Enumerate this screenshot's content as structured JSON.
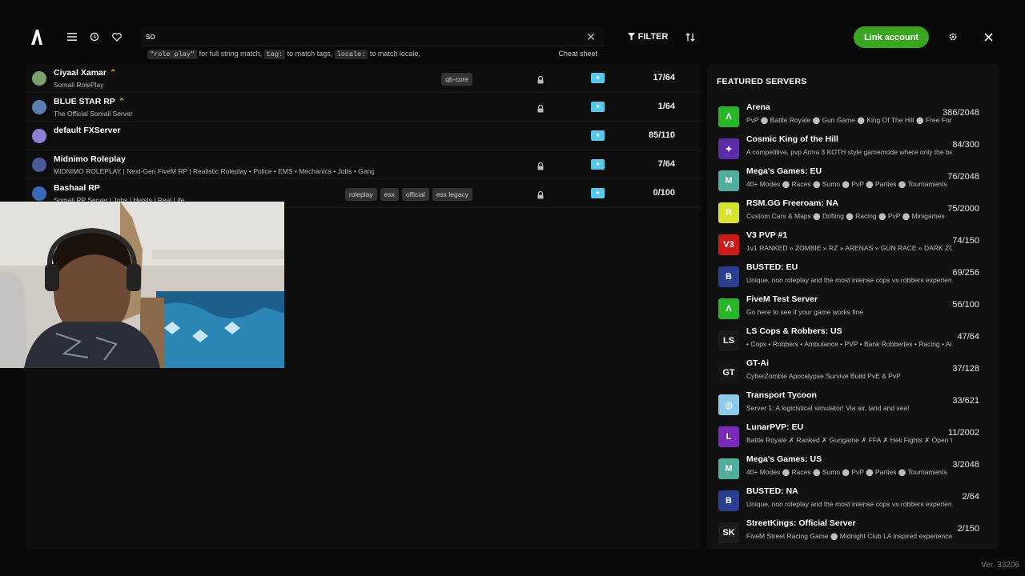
{
  "colors": {
    "accent": "#3aa51f",
    "flag": "#58c8e8",
    "boost": "#e5b63a"
  },
  "nav": {
    "logo": "fivem-logo",
    "menu_icon": "hamburger-icon",
    "history_icon": "history-icon",
    "favorites_icon": "heart-icon"
  },
  "search": {
    "value": "so",
    "hint_1_code": "\"role play\"",
    "hint_1_text": "for full string match,",
    "hint_2_code": "tag:",
    "hint_2_text": "to match tags,",
    "hint_3_code": "locale:",
    "hint_3_text": "to match locale,",
    "cheat_sheet": "Cheat sheet"
  },
  "toolbar": {
    "filter_label": "FILTER",
    "link_account": "Link account"
  },
  "servers": [
    {
      "name": "Ciyaal Xamar",
      "boosted": true,
      "desc": "Somali RolePlay",
      "tags": [
        "qb-core"
      ],
      "locked": true,
      "flag": "★",
      "players": "17/64"
    },
    {
      "name": "BLUE STAR RP",
      "boosted": true,
      "desc": "The Official Somali Server",
      "tags": [],
      "locked": true,
      "flag": "★",
      "players": "1/64"
    },
    {
      "name": "default FXServer",
      "boosted": false,
      "desc": "",
      "tags": [],
      "locked": false,
      "flag": "★",
      "players": "85/110"
    },
    {
      "name": "Midnimo Roleplay",
      "boosted": false,
      "desc": "MIDNIMO ROLEPLAY | Next-Gen FiveM RP | Realistic Roleplay • Police • EMS • Mechanics • Jobs • Gangs",
      "tags": [],
      "locked": true,
      "flag": "★",
      "players": "7/64"
    },
    {
      "name": "Bashaal RP",
      "boosted": false,
      "desc": "Somali RP Server | Jobs | Heists | Real Life",
      "tags": [
        "roleplay",
        "esx",
        "official",
        "esx legacy"
      ],
      "locked": true,
      "flag": "★",
      "players": "0/100"
    }
  ],
  "featured": {
    "title": "FEATURED SERVERS",
    "items": [
      {
        "name": "Arena",
        "desc": "PvP ⬤ Battle Royale ⬤ Gun Game ⬤ King Of The Hill ⬤ Free For All",
        "players": "386/2048",
        "icon_color": "#2ab52a",
        "icon_text": "Λ"
      },
      {
        "name": "Cosmic King of the Hill",
        "desc": "A competitive, pvp Arma 3 KOTH style gamemode where only the best survive",
        "players": "84/300",
        "icon_color": "#5a2ca8",
        "icon_text": "✦"
      },
      {
        "name": "Mega's Games: EU",
        "desc": "40+ Modes ⬤ Races ⬤ Sumo ⬤ PvP ⬤ Parties ⬤ Tournaments",
        "players": "76/2048",
        "icon_color": "#4fae9e",
        "icon_text": "M"
      },
      {
        "name": "RSM.GG Freeroam: NA",
        "desc": "Custom Cars & Maps ⬤ Drifting ⬤ Racing ⬤ PvP ⬤ Minigames",
        "players": "75/2000",
        "icon_color": "#d7e32a",
        "icon_text": "R"
      },
      {
        "name": "V3 PVP #1",
        "desc": "1v1 RANKED » ZOMBIE » RZ » ARENAS » GUN RACE » DARK ZONE",
        "players": "74/150",
        "icon_color": "#cc1a1a",
        "icon_text": "V3"
      },
      {
        "name": "BUSTED: EU",
        "desc": "Unique, non roleplay and the most intense cops vs robbers experience",
        "players": "69/256",
        "icon_color": "#2a3e8e",
        "icon_text": "B"
      },
      {
        "name": "FiveM Test Server",
        "desc": "Go here to see if your game works fine",
        "players": "56/100",
        "icon_color": "#2ab52a",
        "icon_text": "Λ"
      },
      {
        "name": "LS Cops & Robbers: US",
        "desc": "• Cops • Robbers • Ambulance • PVP • Bank Robberies • Racing • Airdrops",
        "players": "47/64",
        "icon_color": "#1a1a1a",
        "icon_text": "LS"
      },
      {
        "name": "GT-Ai",
        "desc": "CyberZombie Apocalypse Survive Build PvE & PvP",
        "players": "37/128",
        "icon_color": "#141414",
        "icon_text": "GT"
      },
      {
        "name": "Transport Tycoon",
        "desc": "Server 1: A logicistical simulator! Via air, land and sea!",
        "players": "33/621",
        "icon_color": "#8fcbe8",
        "icon_text": "◎"
      },
      {
        "name": "LunarPVP: EU",
        "desc": "Battle Royale ✗ Ranked ✗ Gungame ✗ FFA ✗ Heli Fights ✗ Open World",
        "players": "11/2002",
        "icon_color": "#7a2ab8",
        "icon_text": "L"
      },
      {
        "name": "Mega's Games: US",
        "desc": "40+ Modes ⬤ Races ⬤ Sumo ⬤ PvP ⬤ Parties ⬤ Tournaments",
        "players": "3/2048",
        "icon_color": "#4fae9e",
        "icon_text": "M"
      },
      {
        "name": "BUSTED: NA",
        "desc": "Unique, non roleplay and the most intense cops vs robbers experience",
        "players": "2/64",
        "icon_color": "#2a3e8e",
        "icon_text": "B"
      },
      {
        "name": "StreetKings: Official Server",
        "desc": "FiveM Street Racing Game ⬤ Midnight Club LA inspired experience",
        "players": "2/150",
        "icon_color": "#1c1c1c",
        "icon_text": "SK"
      }
    ]
  },
  "version": "Ver. 33206"
}
